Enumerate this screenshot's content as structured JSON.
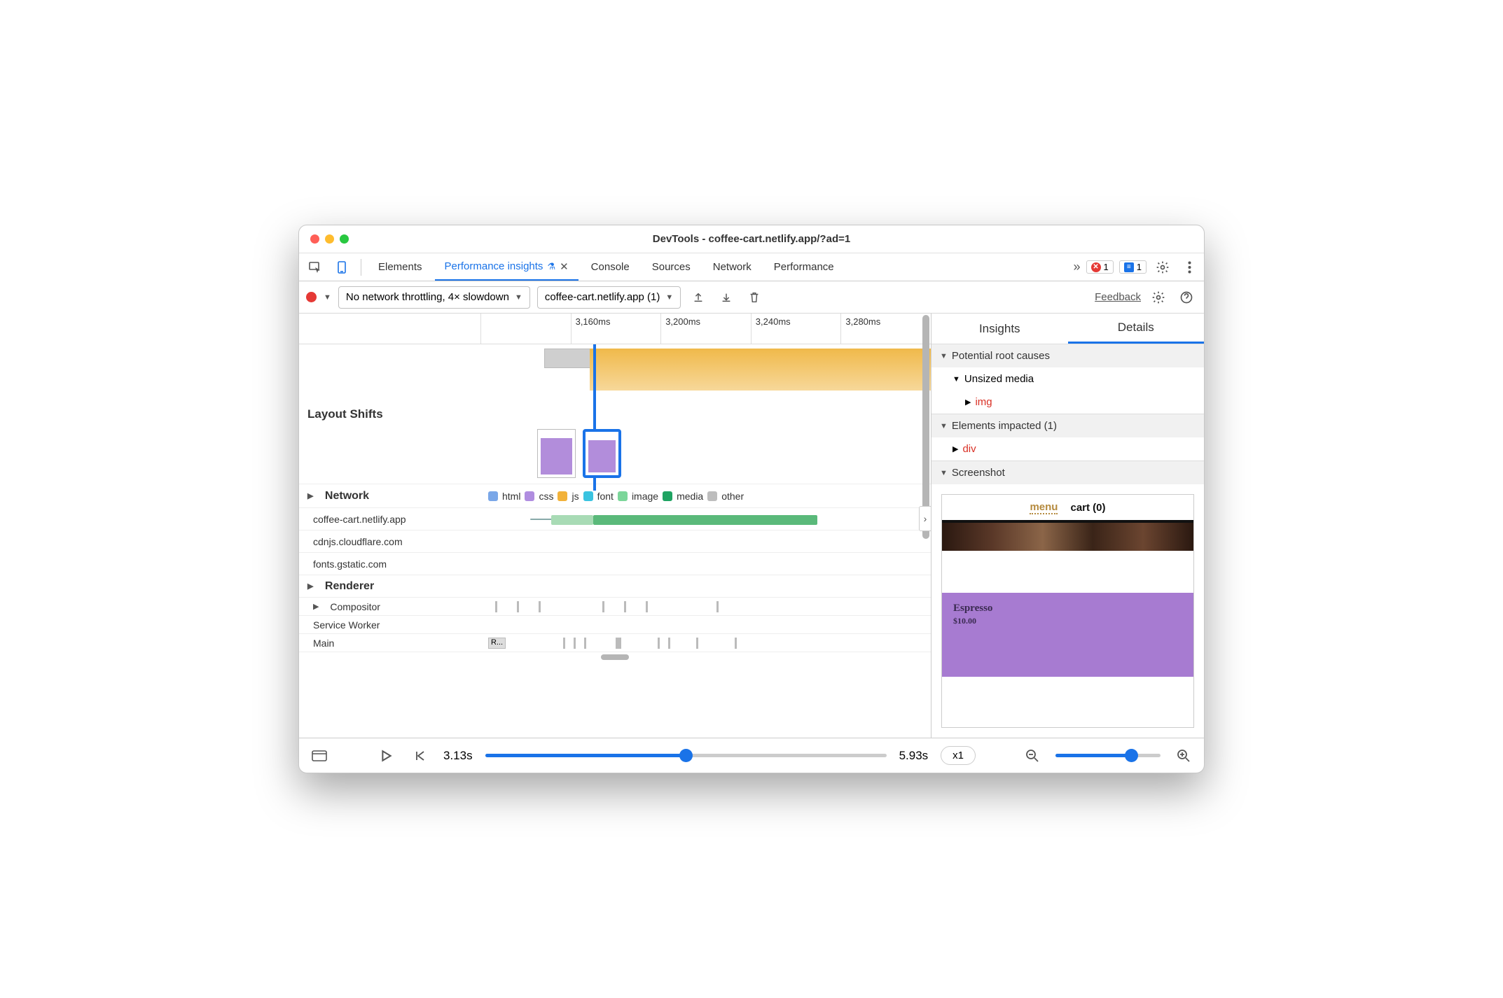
{
  "window_title": "DevTools - coffee-cart.netlify.app/?ad=1",
  "tabs": {
    "elements": "Elements",
    "insights": "Performance insights",
    "console": "Console",
    "sources": "Sources",
    "network": "Network",
    "performance": "Performance"
  },
  "badges": {
    "errors": "1",
    "info": "1"
  },
  "toolbar": {
    "throttle": "No network throttling, 4× slowdown",
    "profile": "coffee-cart.netlify.app (1)",
    "feedback": "Feedback"
  },
  "ruler": [
    "3,160ms",
    "3,200ms",
    "3,240ms",
    "3,280ms"
  ],
  "rows": {
    "layout_shifts": "Layout Shifts",
    "network": "Network",
    "renderer": "Renderer",
    "compositor": "Compositor",
    "service_worker": "Service Worker",
    "main": "Main",
    "main_task": "R..."
  },
  "network_hosts": [
    "coffee-cart.netlify.app",
    "cdnjs.cloudflare.com",
    "fonts.gstatic.com"
  ],
  "legend": {
    "html": "html",
    "css": "css",
    "js": "js",
    "font": "font",
    "image": "image",
    "media": "media",
    "other": "other"
  },
  "legend_colors": {
    "html": "#7aa7e8",
    "css": "#b08de0",
    "js": "#f2b23a",
    "font": "#3ac3e0",
    "image": "#7cd69a",
    "media": "#1fa362",
    "other": "#bdbdbd"
  },
  "side": {
    "tabs": {
      "insights": "Insights",
      "details": "Details"
    },
    "root_causes": "Potential root causes",
    "unsized": "Unsized media",
    "img": "img",
    "impacted": "Elements impacted (1)",
    "div": "div",
    "screenshot": "Screenshot"
  },
  "ss": {
    "menu": "menu",
    "cart": "cart (0)",
    "product": "Espresso",
    "price": "$10.00"
  },
  "bottom": {
    "start": "3.13s",
    "end": "5.93s",
    "speed": "x1"
  }
}
